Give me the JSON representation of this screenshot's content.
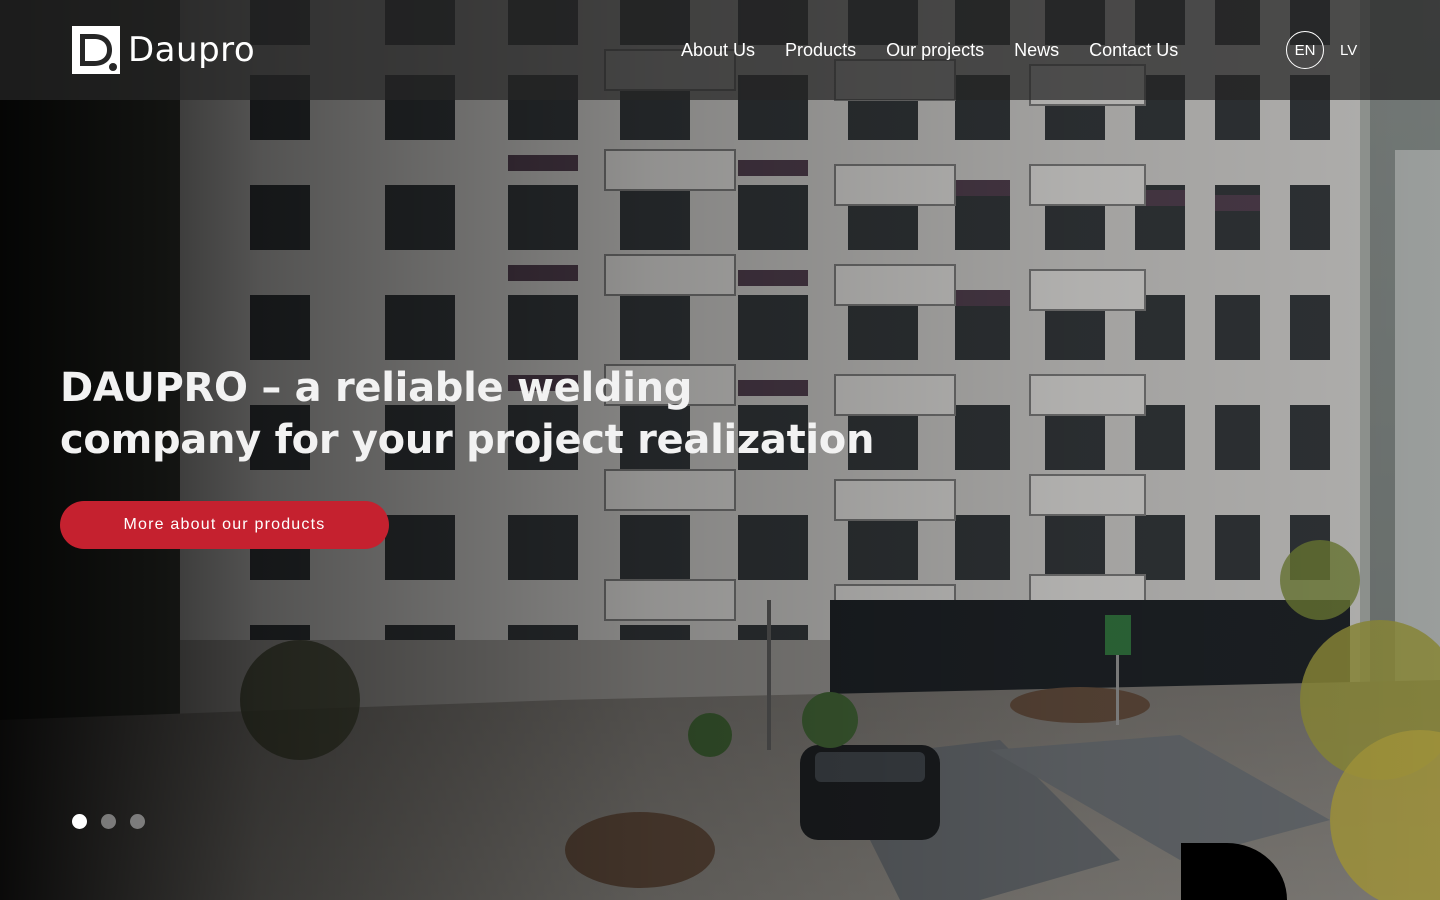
{
  "header": {
    "logo_text": "Daupro",
    "nav": [
      {
        "label": "About Us"
      },
      {
        "label": "Products"
      },
      {
        "label": "Our projects"
      },
      {
        "label": "News"
      },
      {
        "label": "Contact Us"
      }
    ],
    "languages": {
      "active": "EN",
      "other": "LV"
    }
  },
  "hero": {
    "headline_line1": "DAUPRO – a reliable welding",
    "headline_line2": "company for your project realization",
    "cta_label": "More about our products",
    "slides": {
      "count": 3,
      "active_index": 0
    }
  },
  "colors": {
    "accent": "#c5212f",
    "header_bg": "#262626",
    "text": "#ffffff"
  },
  "icons": {
    "logo": "daupro-d-logo-icon"
  }
}
